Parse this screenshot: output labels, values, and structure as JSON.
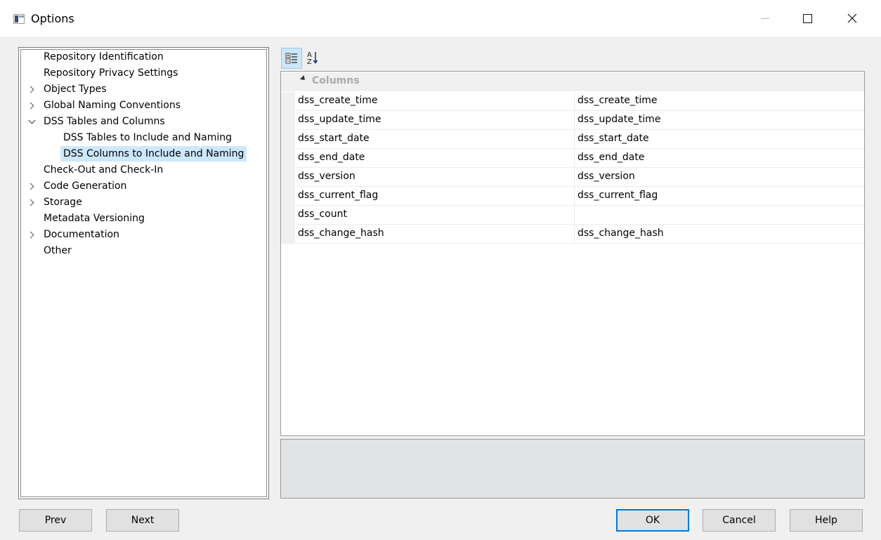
{
  "window": {
    "title": "Options",
    "minimize_icon": "minimize-icon",
    "maximize_icon": "maximize-icon",
    "close_icon": "close-icon"
  },
  "tree": {
    "items": [
      {
        "label": "Repository Identification",
        "expander": "none",
        "level": 0
      },
      {
        "label": "Repository Privacy Settings",
        "expander": "none",
        "level": 0
      },
      {
        "label": "Object Types",
        "expander": "collapsed",
        "level": 0
      },
      {
        "label": "Global Naming Conventions",
        "expander": "collapsed",
        "level": 0
      },
      {
        "label": "DSS Tables and Columns",
        "expander": "expanded",
        "level": 0
      },
      {
        "label": "DSS Tables to Include and Naming",
        "expander": "none",
        "level": 1
      },
      {
        "label": "DSS Columns to Include and Naming",
        "expander": "none",
        "level": 1,
        "selected": true
      },
      {
        "label": "Check-Out and Check-In",
        "expander": "none",
        "level": 0
      },
      {
        "label": "Code Generation",
        "expander": "collapsed",
        "level": 0
      },
      {
        "label": "Storage",
        "expander": "collapsed",
        "level": 0
      },
      {
        "label": "Metadata Versioning",
        "expander": "none",
        "level": 0
      },
      {
        "label": "Documentation",
        "expander": "collapsed",
        "level": 0
      },
      {
        "label": "Other",
        "expander": "none",
        "level": 0
      }
    ]
  },
  "toolbar": {
    "categorized_icon": "categorized-view-icon",
    "alphabetical_icon": "sort-alphabetical-icon"
  },
  "property_grid": {
    "category": "Columns",
    "rows": [
      {
        "name": "dss_create_time",
        "value": "dss_create_time"
      },
      {
        "name": "dss_update_time",
        "value": "dss_update_time"
      },
      {
        "name": "dss_start_date",
        "value": "dss_start_date"
      },
      {
        "name": "dss_end_date",
        "value": "dss_end_date"
      },
      {
        "name": "dss_version",
        "value": "dss_version"
      },
      {
        "name": "dss_current_flag",
        "value": "dss_current_flag"
      },
      {
        "name": "dss_count",
        "value": ""
      },
      {
        "name": "dss_change_hash",
        "value": "dss_change_hash"
      }
    ]
  },
  "buttons": {
    "prev": "Prev",
    "next": "Next",
    "ok": "OK",
    "cancel": "Cancel",
    "help": "Help"
  },
  "colors": {
    "selection": "#cce8ff",
    "accent": "#0078d7",
    "description_bg": "#e1e3e7"
  }
}
